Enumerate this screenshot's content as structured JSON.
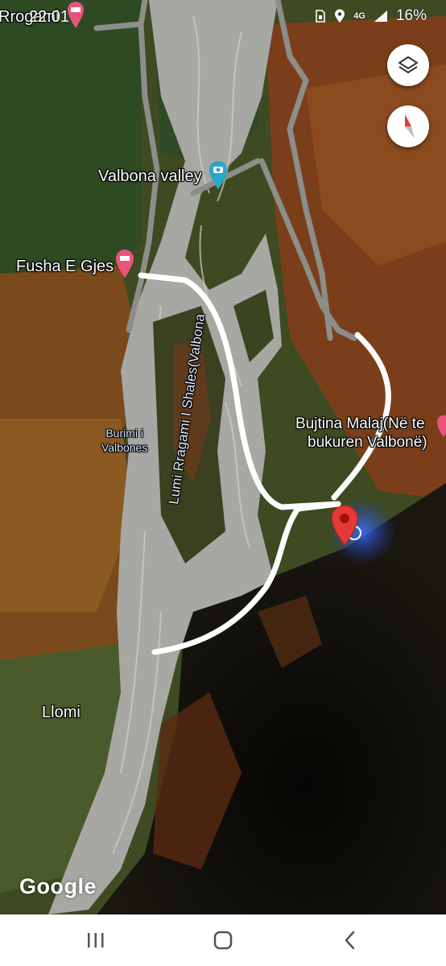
{
  "status_bar": {
    "time": "22:01",
    "network": "4G",
    "battery": "16%",
    "icons": [
      "sim-icon",
      "location-icon",
      "signal-icon",
      "battery-icon"
    ]
  },
  "map": {
    "type": "satellite",
    "labels": {
      "top_left": "Rrogami",
      "valbona_valley": "Valbona valley",
      "fusha": "Fusha E Gjes",
      "burimi_line1": "Burimi i",
      "burimi_line2": "Valbones",
      "river": "Lumi Rragami I Shales(Valbona",
      "bujtina_line1": "Bujtina Malaj(Në te",
      "bujtina_line2": "bukuren Valbonë)",
      "llomi": "Llomi"
    },
    "pins": [
      {
        "name": "hotel-pin",
        "color": "#e8547a"
      },
      {
        "name": "camera-pin",
        "color": "#29a6c9"
      },
      {
        "name": "selected-pin",
        "color": "#e53935"
      }
    ],
    "drawn_route_color": "#ffffff",
    "attribution": "Google"
  },
  "controls": {
    "layers_button": "layers-icon",
    "compass_button": "compass-icon"
  },
  "nav_bar": {
    "recents": "recents-icon",
    "home": "home-icon",
    "back": "back-icon"
  }
}
